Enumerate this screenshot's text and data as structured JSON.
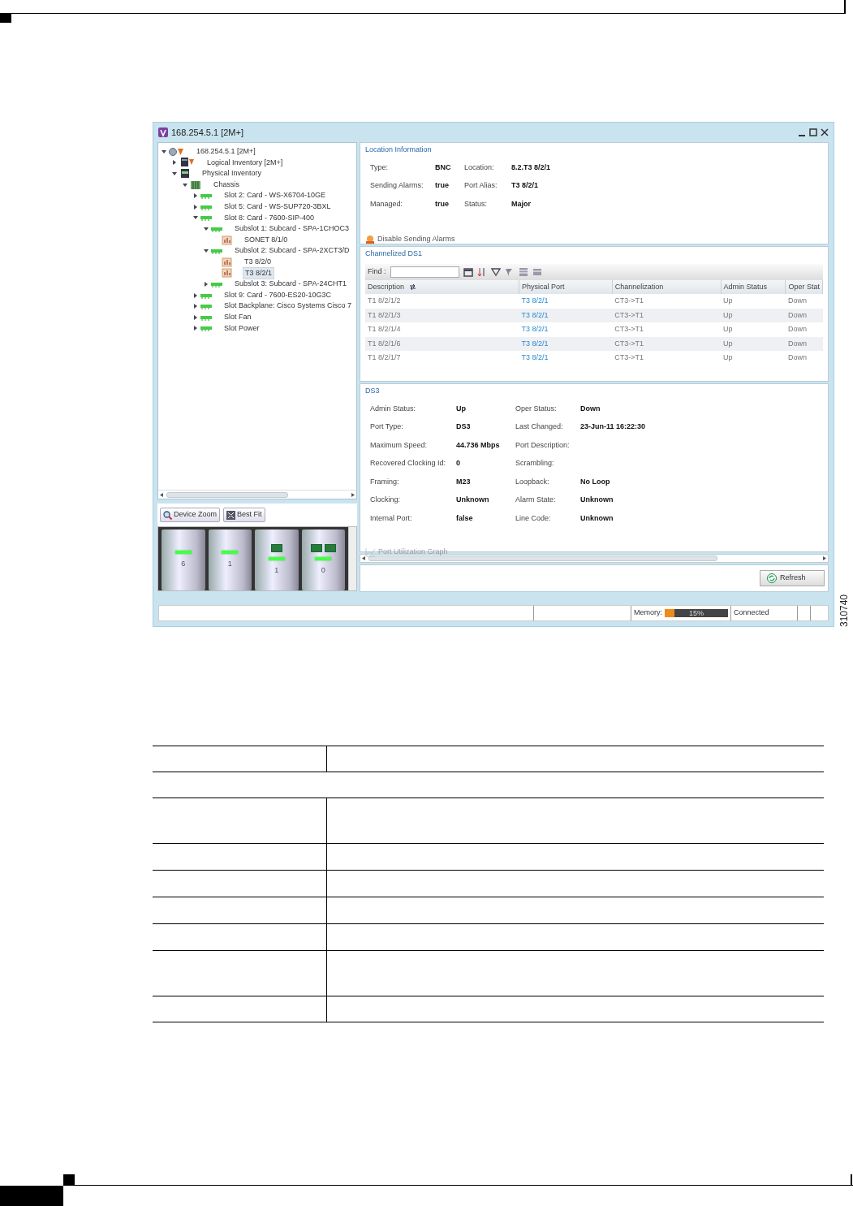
{
  "window": {
    "title": "168.254.5.1 [2M+]"
  },
  "tree": [
    {
      "label": "168.254.5.1 [2M+]",
      "kind": "device",
      "expanded": true,
      "selected": false,
      "children": [
        {
          "label": "Logical Inventory [2M+]",
          "kind": "logical",
          "expanded": false,
          "selected": false
        },
        {
          "label": "Physical Inventory",
          "kind": "physical",
          "expanded": true,
          "selected": false,
          "children": [
            {
              "label": "Chassis",
              "kind": "chassis",
              "expanded": true,
              "selected": false,
              "children": [
                {
                  "label": "Slot 2: Card - WS-X6704-10GE",
                  "kind": "card",
                  "expanded": false,
                  "selected": false
                },
                {
                  "label": "Slot 5: Card - WS-SUP720-3BXL",
                  "kind": "card",
                  "expanded": false,
                  "selected": false
                },
                {
                  "label": "Slot 8: Card - 7600-SIP-400",
                  "kind": "card",
                  "expanded": true,
                  "selected": false,
                  "children": [
                    {
                      "label": "Subslot 1: Subcard - SPA-1CHOC3",
                      "kind": "card",
                      "expanded": true,
                      "selected": false,
                      "children": [
                        {
                          "label": "SONET 8/1/0",
                          "kind": "port",
                          "selected": false
                        }
                      ]
                    },
                    {
                      "label": "Subslot 2: Subcard - SPA-2XCT3/D",
                      "kind": "card",
                      "expanded": true,
                      "selected": false,
                      "children": [
                        {
                          "label": "T3 8/2/0",
                          "kind": "port",
                          "selected": false
                        },
                        {
                          "label": "T3 8/2/1",
                          "kind": "port",
                          "selected": true
                        }
                      ]
                    },
                    {
                      "label": "Subslot 3: Subcard - SPA-24CHT1",
                      "kind": "card",
                      "expanded": false,
                      "selected": false
                    }
                  ]
                },
                {
                  "label": "Slot 9: Card - 7600-ES20-10G3C",
                  "kind": "card",
                  "expanded": false,
                  "selected": false
                },
                {
                  "label": "Slot Backplane: Cisco Systems Cisco 7",
                  "kind": "card",
                  "expanded": false,
                  "selected": false
                },
                {
                  "label": "Slot Fan",
                  "kind": "card",
                  "expanded": false,
                  "selected": false
                },
                {
                  "label": "Slot Power",
                  "kind": "card",
                  "expanded": false,
                  "selected": false
                }
              ]
            }
          ]
        }
      ]
    }
  ],
  "device_view": {
    "buttons": [
      {
        "label": "Device Zoom",
        "kind": "zoom"
      },
      {
        "label": "Best Fit",
        "kind": "fit"
      }
    ],
    "slots": [
      {
        "label": "6",
        "kind": "plain"
      },
      {
        "label": "1",
        "kind": "plain"
      },
      {
        "label": "1",
        "kind": "ports"
      },
      {
        "label": "0",
        "kind": "ports"
      }
    ]
  },
  "location": {
    "title": "Location Information",
    "fields": [
      {
        "label": "Type:",
        "value": "BNC"
      },
      {
        "label": "Location:",
        "value": "8.2.T3 8/2/1"
      },
      {
        "label": "Sending Alarms:",
        "value": "true"
      },
      {
        "label": "Port Alias:",
        "value": "T3 8/2/1"
      },
      {
        "label": "Managed:",
        "value": "true"
      },
      {
        "label": "Status:",
        "value": "Major"
      }
    ],
    "action": {
      "label": "Disable Sending Alarms",
      "disabled": false
    }
  },
  "ds1": {
    "title": "Channelized DS1",
    "find_label": "Find :",
    "columns": [
      "Description",
      "Physical Port",
      "Channelization",
      "Admin Status",
      "Oper Stat"
    ],
    "rows": [
      [
        "T1 8/2/1/2",
        "T3 8/2/1",
        "CT3->T1",
        "Up",
        "Down"
      ],
      [
        "T1 8/2/1/3",
        "T3 8/2/1",
        "CT3->T1",
        "Up",
        "Down"
      ],
      [
        "T1 8/2/1/4",
        "T3 8/2/1",
        "CT3->T1",
        "Up",
        "Down"
      ],
      [
        "T1 8/2/1/6",
        "T3 8/2/1",
        "CT3->T1",
        "Up",
        "Down"
      ],
      [
        "T1 8/2/1/7",
        "T3 8/2/1",
        "CT3->T1",
        "Up",
        "Down"
      ]
    ]
  },
  "ds3": {
    "title": "DS3",
    "fields": [
      {
        "label": "Admin Status:",
        "value": "Up"
      },
      {
        "label": "Oper Status:",
        "value": "Down"
      },
      {
        "label": "Port Type:",
        "value": "DS3"
      },
      {
        "label": "Last Changed:",
        "value": "23-Jun-11 16:22:30"
      },
      {
        "label": "Maximum Speed:",
        "value": "44.736 Mbps"
      },
      {
        "label": "Port Description:"
      },
      {
        "label": "Recovered Clocking Id:",
        "value": "0"
      },
      {
        "label": "Scrambling:"
      },
      {
        "label": "Framing:",
        "value": "M23"
      },
      {
        "label": "Loopback:",
        "value": "No Loop"
      },
      {
        "label": "Clocking:",
        "value": "Unknown"
      },
      {
        "label": "Alarm State:",
        "value": "Unknown"
      },
      {
        "label": "Internal Port:",
        "value": "false"
      },
      {
        "label": "Line Code:",
        "value": "Unknown"
      }
    ],
    "action": {
      "label": "Port Utilization Graph",
      "disabled": true
    }
  },
  "refresh": "Refresh",
  "status_bar": {
    "memory_label": "Memory:",
    "memory": {
      "level": 0.15
    },
    "memory_text": "15%",
    "connection": "Connected"
  },
  "figure_id": "310740"
}
